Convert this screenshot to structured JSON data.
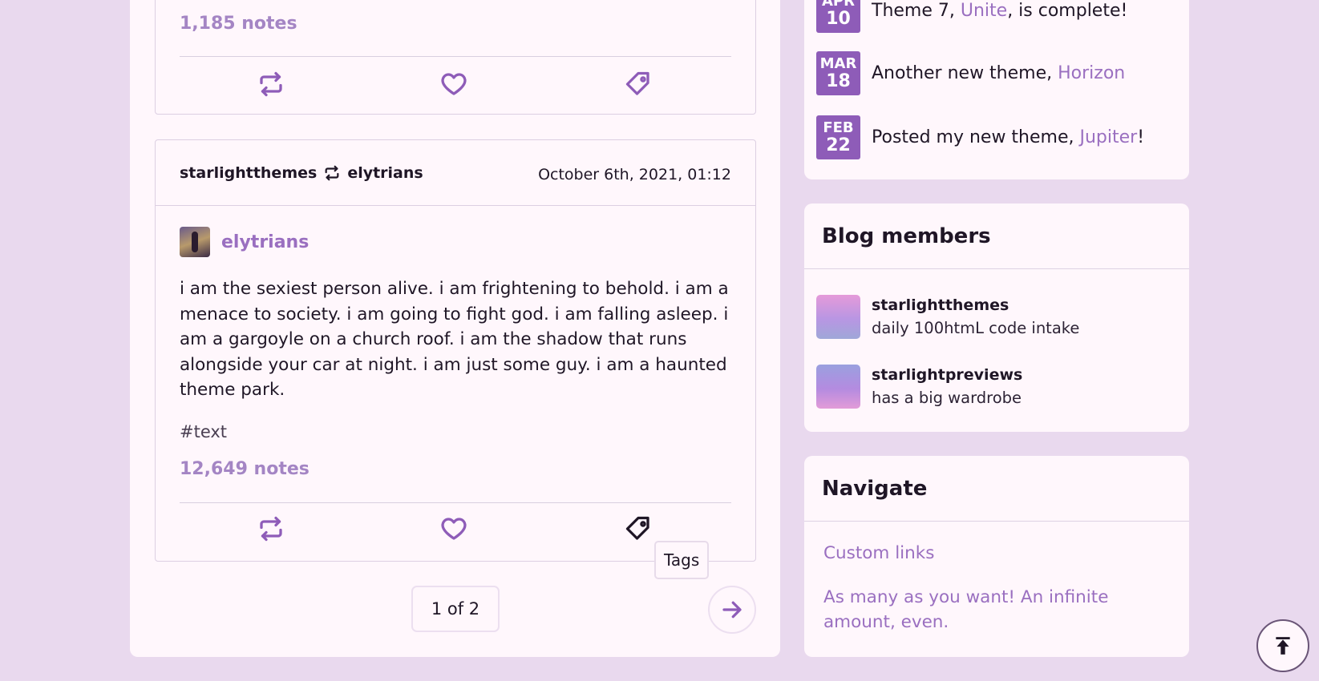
{
  "post_a": {
    "notes": "1,185 notes"
  },
  "post_b": {
    "reblogger": "starlightthemes",
    "original_author": "elytrians",
    "date": "October 6th, 2021, 01:12",
    "author": "elytrians",
    "body": "i am the sexiest person alive. i am frightening to behold. i am a menace to society. i am going to fight god. i am falling asleep. i am a gargoyle on a church roof. i am the shadow that runs alongside your car at night. i am just some guy. i am a haunted theme park.",
    "tag": "#text",
    "notes": "12,649 notes",
    "tooltip": "Tags"
  },
  "pagination": {
    "label": "1 of 2"
  },
  "updates": [
    {
      "month": "APR",
      "day": "10",
      "prefix": "Theme 7, ",
      "link": "Unite",
      "suffix": ", is complete!"
    },
    {
      "month": "MAR",
      "day": "18",
      "prefix": "Another new theme, ",
      "link": "Horizon",
      "suffix": ""
    },
    {
      "month": "FEB",
      "day": "22",
      "prefix": "Posted my new theme, ",
      "link": "Jupiter",
      "suffix": "!"
    }
  ],
  "members": {
    "title": "Blog members",
    "items": [
      {
        "name": "starlightthemes",
        "desc": "daily 100htmL code intake"
      },
      {
        "name": "starlightpreviews",
        "desc": "has a big wardrobe"
      }
    ]
  },
  "navigate": {
    "title": "Navigate",
    "links": [
      "Custom links",
      "As many as you want! An infinite amount, even."
    ]
  },
  "colors": {
    "accent": "#9a6fc0",
    "badge": "#8e5cb8",
    "page_bg": "#e9d9ee",
    "card_bg": "#fff7fc"
  },
  "icons": [
    "reblog-icon",
    "heart-icon",
    "tag-icon",
    "arrow-right-icon",
    "back-to-top-icon"
  ]
}
